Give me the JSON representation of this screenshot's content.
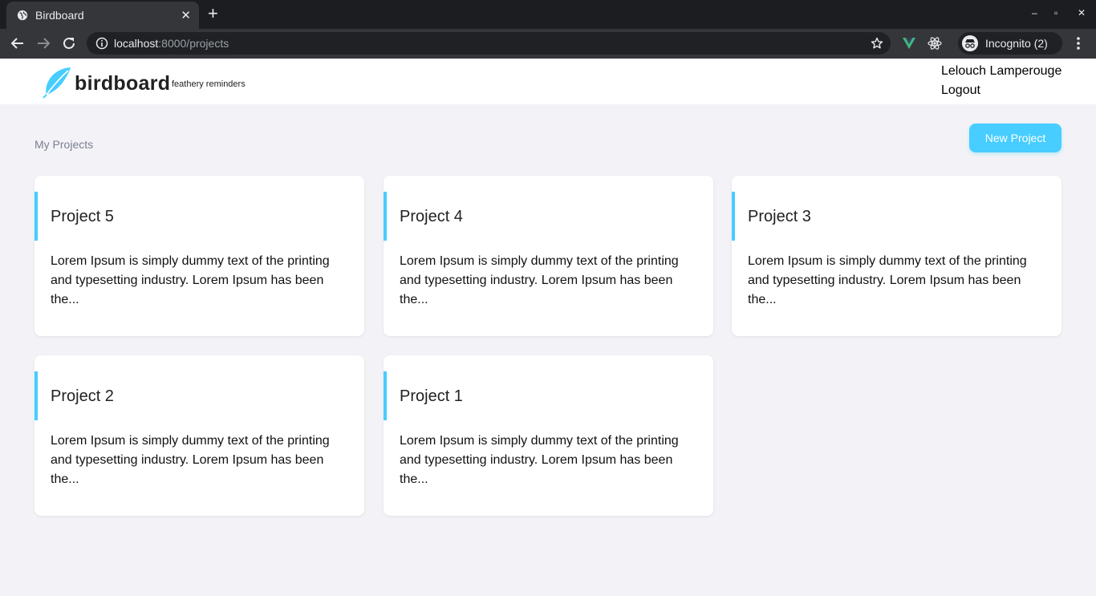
{
  "browser": {
    "tab_title": "Birdboard",
    "url_host": "localhost",
    "url_rest": ":8000/projects",
    "profile_label": "Incognito (2)",
    "new_tab": "+",
    "minimize": "–",
    "maximize": "▫",
    "close": "✕",
    "tab_close": "✕"
  },
  "header": {
    "brand": "birdboard",
    "tagline": "feathery reminders",
    "user_name": "Lelouch Lamperouge",
    "logout_label": "Logout"
  },
  "main": {
    "section_title": "My Projects",
    "new_project_label": "New Project"
  },
  "projects": [
    {
      "title": "Project 5",
      "description": "Lorem Ipsum is simply dummy text of the printing and typesetting industry. Lorem Ipsum has been the..."
    },
    {
      "title": "Project 4",
      "description": "Lorem Ipsum is simply dummy text of the printing and typesetting industry. Lorem Ipsum has been the..."
    },
    {
      "title": "Project 3",
      "description": "Lorem Ipsum is simply dummy text of the printing and typesetting industry. Lorem Ipsum has been the..."
    },
    {
      "title": "Project 2",
      "description": "Lorem Ipsum is simply dummy text of the printing and typesetting industry. Lorem Ipsum has been the..."
    },
    {
      "title": "Project 1",
      "description": "Lorem Ipsum is simply dummy text of the printing and typesetting industry. Lorem Ipsum has been the..."
    }
  ],
  "colors": {
    "accent": "#47cdff",
    "page_background": "#f3f3f7",
    "browser_dark": "#35363a"
  },
  "icons": [
    "globe-icon",
    "back-arrow-icon",
    "forward-arrow-icon",
    "reload-icon",
    "info-icon",
    "star-icon",
    "vue-extension-icon",
    "react-extension-icon",
    "incognito-icon",
    "kebab-menu-icon",
    "feather-logo-icon"
  ]
}
